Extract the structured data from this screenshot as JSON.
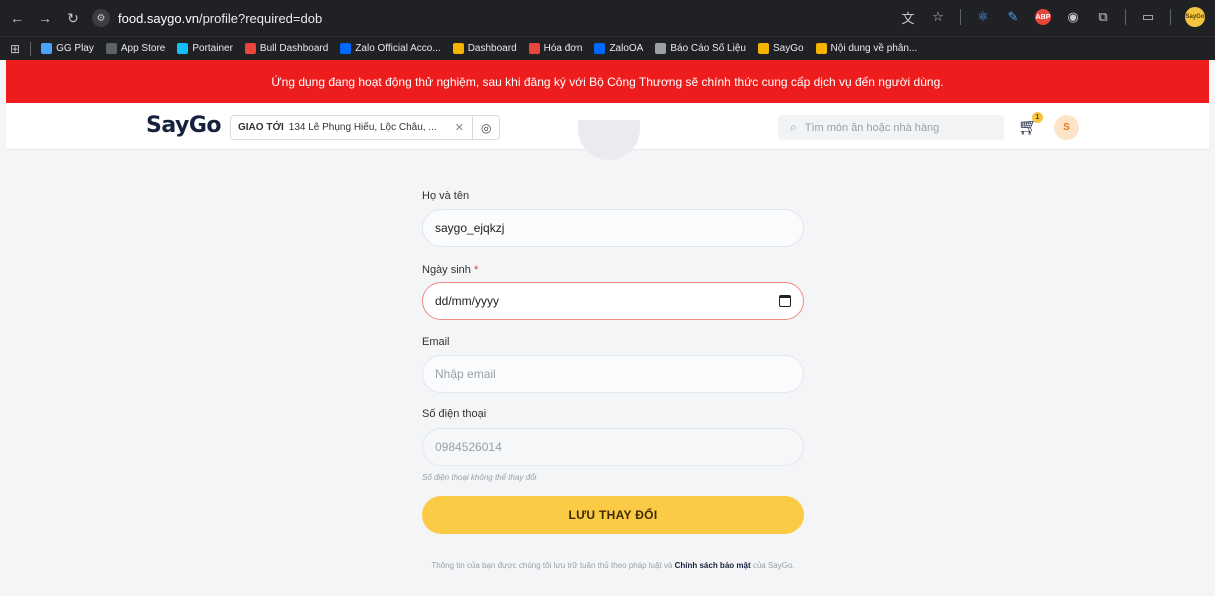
{
  "browser": {
    "url_host": "food.saygo.vn",
    "url_path": "/profile?required=dob",
    "bookmarks": [
      {
        "label": "GG Play",
        "color": "#4aa3ff"
      },
      {
        "label": "App Store",
        "color": "#5f6368"
      },
      {
        "label": "Portainer",
        "color": "#13bef9"
      },
      {
        "label": "Bull Dashboard",
        "color": "#e8453c"
      },
      {
        "label": "Zalo Official Acco...",
        "color": "#0068ff"
      },
      {
        "label": "Dashboard",
        "color": "#f5b400"
      },
      {
        "label": "Hóa đơn",
        "color": "#e8453c"
      },
      {
        "label": "ZaloOA",
        "color": "#0068ff"
      },
      {
        "label": "Báo Cáo Số Liệu",
        "color": "#9aa0a6"
      },
      {
        "label": "SayGo",
        "color": "#f5b400"
      },
      {
        "label": "Nội dung về phân...",
        "color": "#f5b400"
      }
    ]
  },
  "banner": {
    "text": "Ứng dụng đang hoạt động thử nghiệm, sau khi đăng ký với Bộ Công Thương sẽ chính thức cung cấp dịch vụ đến người dùng."
  },
  "header": {
    "logo": "SayGo",
    "deliver_label": "GIAO TỚI",
    "deliver_address": "134 Lê Phụng Hiểu, Lộc Châu, ...",
    "search_placeholder": "Tìm món ăn hoặc nhà hàng",
    "cart_count": "1",
    "avatar_initial": "S"
  },
  "form": {
    "name_label": "Họ và tên",
    "name_value": "saygo_ejqkzj",
    "dob_label": "Ngày sinh",
    "dob_required_mark": "*",
    "dob_placeholder": "dd/mm/yyyy",
    "email_label": "Email",
    "email_placeholder": "Nhập email",
    "phone_label": "Số điện thoại",
    "phone_value": "0984526014",
    "phone_hint": "Số điện thoại không thể thay đổi",
    "save_label": "LƯU THAY ĐỔI",
    "privacy_prefix": "Thông tin của bạn được chúng tôi lưu trữ tuân thủ theo pháp luật và",
    "privacy_link": "Chính sách bảo mật",
    "privacy_suffix": "của SayGo."
  },
  "colors": {
    "banner_bg": "#ee1d1d",
    "accent_yellow": "#fbcb45",
    "error_border": "#f28b82",
    "brand_navy": "#16213e"
  }
}
